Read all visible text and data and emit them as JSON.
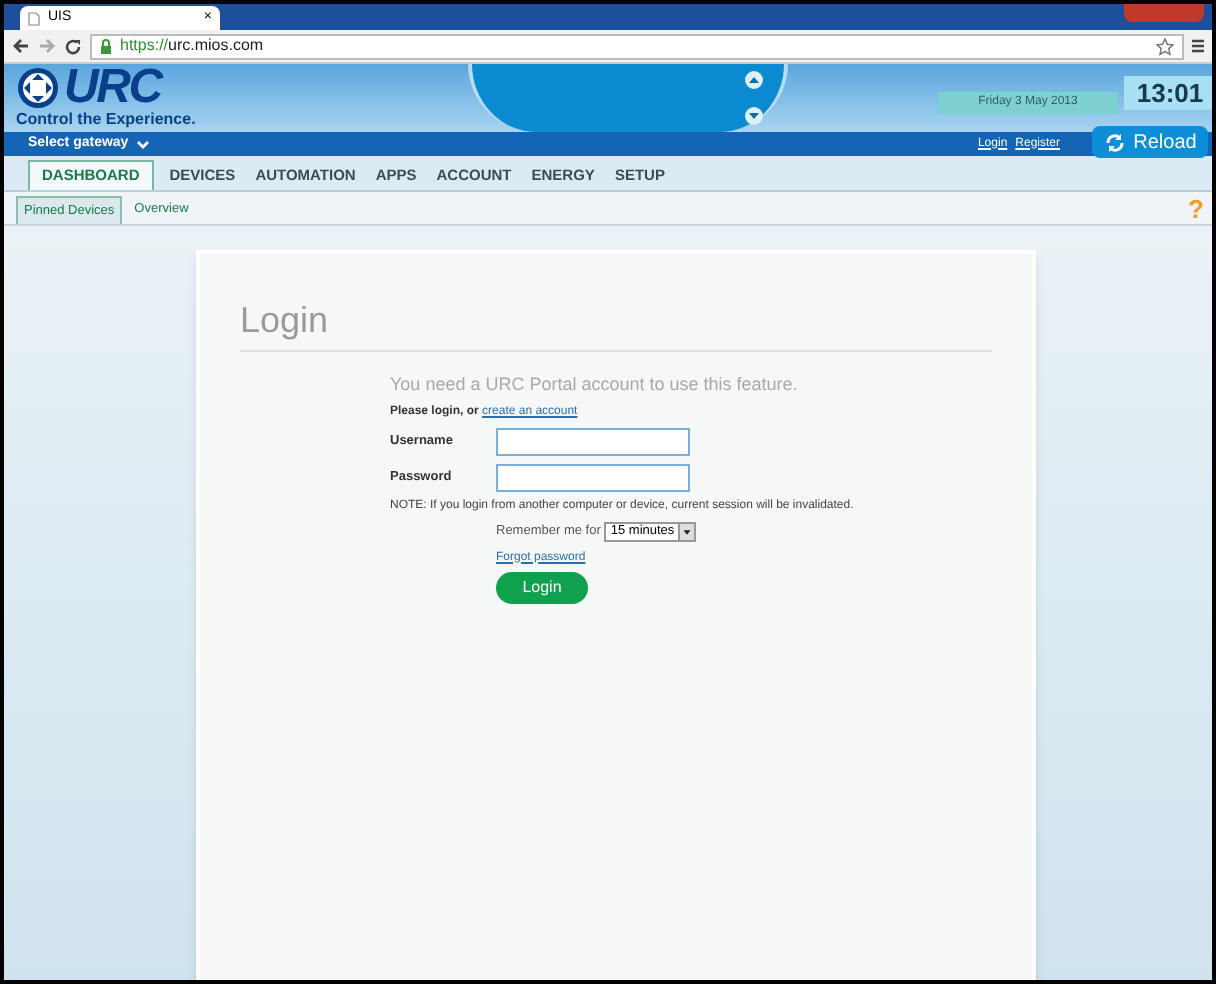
{
  "browser": {
    "tab_title": "UIS",
    "tab_close": "×",
    "url_scheme": "https://",
    "url_host": "urc.mios.com"
  },
  "header": {
    "logo": "URC",
    "tagline": "Control the Experience.",
    "date": "Friday 3 May 2013",
    "time": "13:01",
    "gateway": "Select gateway",
    "links": [
      "Login",
      "Register"
    ],
    "reload": "Reload"
  },
  "tabs": [
    {
      "label": "DASHBOARD",
      "selected": true
    },
    {
      "label": "DEVICES",
      "selected": false
    },
    {
      "label": "AUTOMATION",
      "selected": false
    },
    {
      "label": "APPS",
      "selected": false
    },
    {
      "label": "ACCOUNT",
      "selected": false
    },
    {
      "label": "ENERGY",
      "selected": false
    },
    {
      "label": "SETUP",
      "selected": false
    }
  ],
  "subtabs": [
    {
      "label": "Pinned Devices",
      "selected": true
    },
    {
      "label": "Overview",
      "selected": false
    }
  ],
  "help": "?",
  "login": {
    "title": "Login",
    "notice": "You need a URC Portal account to use this feature.",
    "prompt": "Please login, or ",
    "prompt_link": "create an account",
    "fields": [
      {
        "label": "Username"
      },
      {
        "label": "Password"
      }
    ],
    "note": "NOTE: If you login from another computer or device, current session will be invalidated.",
    "remember_label": "Remember me for",
    "duration": "15 minutes",
    "forgot": "Forgot password",
    "button": "Login"
  }
}
